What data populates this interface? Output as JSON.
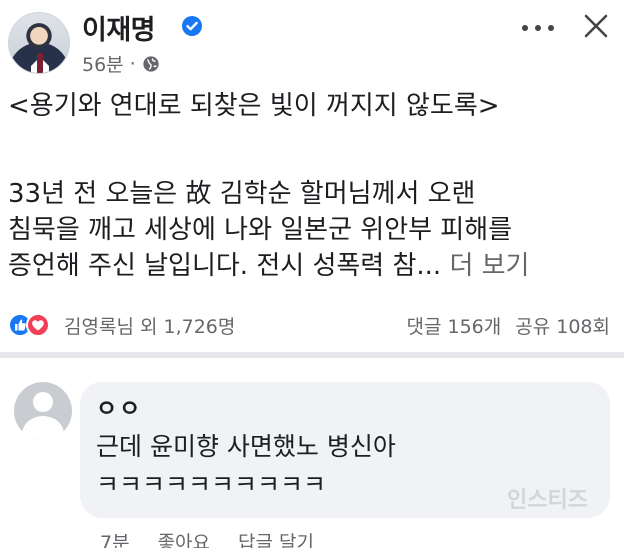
{
  "post": {
    "author": "이재명",
    "time": "56분",
    "dot": "·",
    "title": "<용기와 연대로 되찾은 빛이 꺼지지 않도록>",
    "lines": [
      "33년 전 오늘은 故 김학순 할머님께서 오랜",
      "침묵을 깨고 세상에 나와 일본군 위안부 피해를",
      "증언해 주신 날입니다. 전시 성폭력 참..."
    ],
    "see_more": "더 보기"
  },
  "reactions": {
    "reactors": "김영록님 외 1,726명",
    "comments": "댓글 156개",
    "shares": "공유 108회"
  },
  "comment": {
    "name": "ㅇㅇ",
    "line1": "근데 윤미향 사면했노 병신아",
    "line2": "ㅋㅋㅋㅋㅋㅋㅋㅋㅋㅋ",
    "watermark": "인스티즈",
    "time": "7분",
    "like": "좋아요",
    "reply": "답글 달기"
  },
  "colors": {
    "accent": "#1877f2",
    "love": "#f33e58",
    "bubble": "#f0f2f5",
    "muted": "#65676b"
  },
  "icons": [
    "verified-icon",
    "globe-icon",
    "more-icon",
    "close-icon",
    "like-reaction-icon",
    "love-reaction-icon",
    "default-avatar-icon"
  ]
}
